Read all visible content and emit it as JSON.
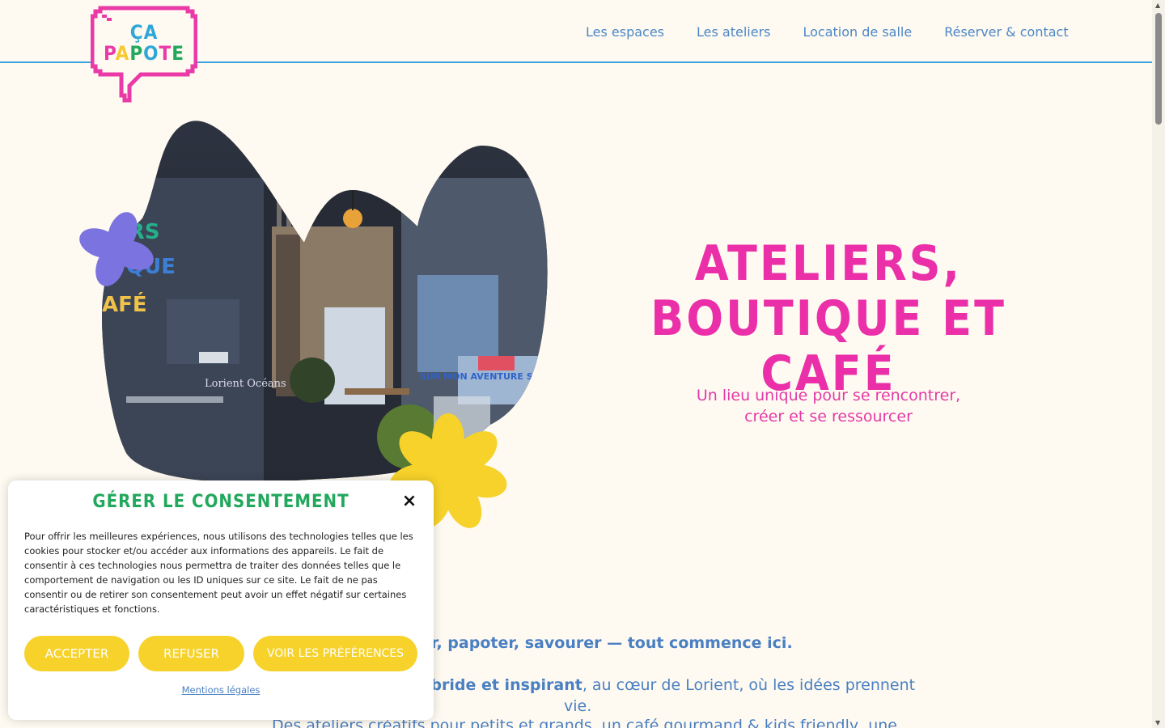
{
  "logo": {
    "line1": "ÇA",
    "line2_letters": [
      "P",
      "A",
      "P",
      "O",
      "T",
      "E"
    ],
    "line2_colors": [
      "#e93aa8",
      "#f7c930",
      "#22a85c",
      "#2fa7d8",
      "#e93aa8",
      "#22a85c"
    ],
    "frame_color": "#e93aa8"
  },
  "nav": [
    {
      "label": "Les espaces"
    },
    {
      "label": "Les ateliers"
    },
    {
      "label": "Location de salle"
    },
    {
      "label": "Réserver & contact"
    }
  ],
  "hero": {
    "title_line1": "ATELIERS,",
    "title_line2": "BOUTIQUE ET CAFÉ",
    "subtitle_line1": "Un lieu unique pour se rencontrer,",
    "subtitle_line2": "créer et se ressourcer",
    "window_sign": [
      "ERS",
      "QUE",
      "AFÉ"
    ],
    "poster_text": "SUR MON AVENTURE SU",
    "photo_caption": "Lorient Océans"
  },
  "intro": {
    "line1": "er, papoter, savourer — tout commence ici.",
    "line2_bold": "ybride et inspirant",
    "line2_rest": ", au cœur de Lorient, où les idées prennent",
    "line3": "vie.",
    "line4": "Des ateliers créatifs pour petits et grands, un café gourmand & kids friendly, une"
  },
  "consent": {
    "title": "GÉRER LE CONSENTEMENT",
    "close": "×",
    "text": "Pour offrir les meilleures expériences, nous utilisons des technologies telles que les cookies pour stocker et/ou accéder aux informations des appareils. Le fait de consentir à ces technologies nous permettra de traiter des données telles que le comportement de navigation ou les ID uniques sur ce site. Le fait de ne pas consentir ou de retirer son consentement peut avoir un effet négatif sur certaines caractéristiques et fonctions.",
    "accept": "Accepter",
    "refuse": "Refuser",
    "prefs": "Voir les préférences",
    "legal": "Mentions légales"
  },
  "colors": {
    "background": "#fefaf1",
    "pink": "#ea2fa8",
    "blue": "#4a7fc2",
    "yellow": "#f7d22a",
    "green": "#22a85c",
    "purple": "#7b73e0",
    "header_border": "#3aa3dd"
  },
  "icons": {
    "close": "close-icon",
    "scroll_up": "chevron-up-icon",
    "scroll_down": "chevron-down-icon"
  }
}
